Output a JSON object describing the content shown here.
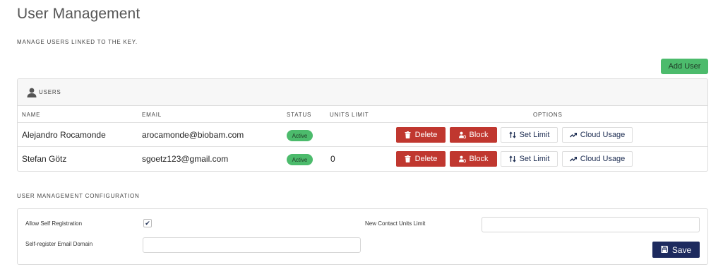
{
  "page": {
    "title": "User Management",
    "subtitle": "MANAGE USERS LINKED TO THE KEY."
  },
  "toolbar": {
    "add_user_label": "Add User"
  },
  "users_panel": {
    "header": "USERS",
    "header_icon": "user-icon",
    "columns": {
      "name": "NAME",
      "email": "EMAIL",
      "status": "STATUS",
      "units_limit": "UNITS LIMIT",
      "options": "OPTIONS"
    },
    "rows": [
      {
        "name": "Alejandro Rocamonde",
        "email": "arocamonde@biobam.com",
        "status": "Active",
        "units_limit": "",
        "actions": {
          "delete": "Delete",
          "block": "Block",
          "set_limit": "Set Limit",
          "cloud_usage": "Cloud Usage"
        }
      },
      {
        "name": "Stefan Götz",
        "email": "sgoetz123@gmail.com",
        "status": "Active",
        "units_limit": "0",
        "actions": {
          "delete": "Delete",
          "block": "Block",
          "set_limit": "Set Limit",
          "cloud_usage": "Cloud Usage"
        }
      }
    ]
  },
  "config": {
    "title": "USER MANAGEMENT CONFIGURATION",
    "allow_self_registration_label": "Allow Self Registration",
    "allow_self_registration_checked": true,
    "self_register_domain_label": "Self-register Email Domain",
    "self_register_domain_value": "",
    "new_contact_units_limit_label": "New Contact Units Limit",
    "new_contact_units_limit_value": "",
    "save_label": "Save"
  },
  "colors": {
    "green": "#4cbb6c",
    "red": "#c0372f",
    "navy": "#1d2a5e"
  }
}
